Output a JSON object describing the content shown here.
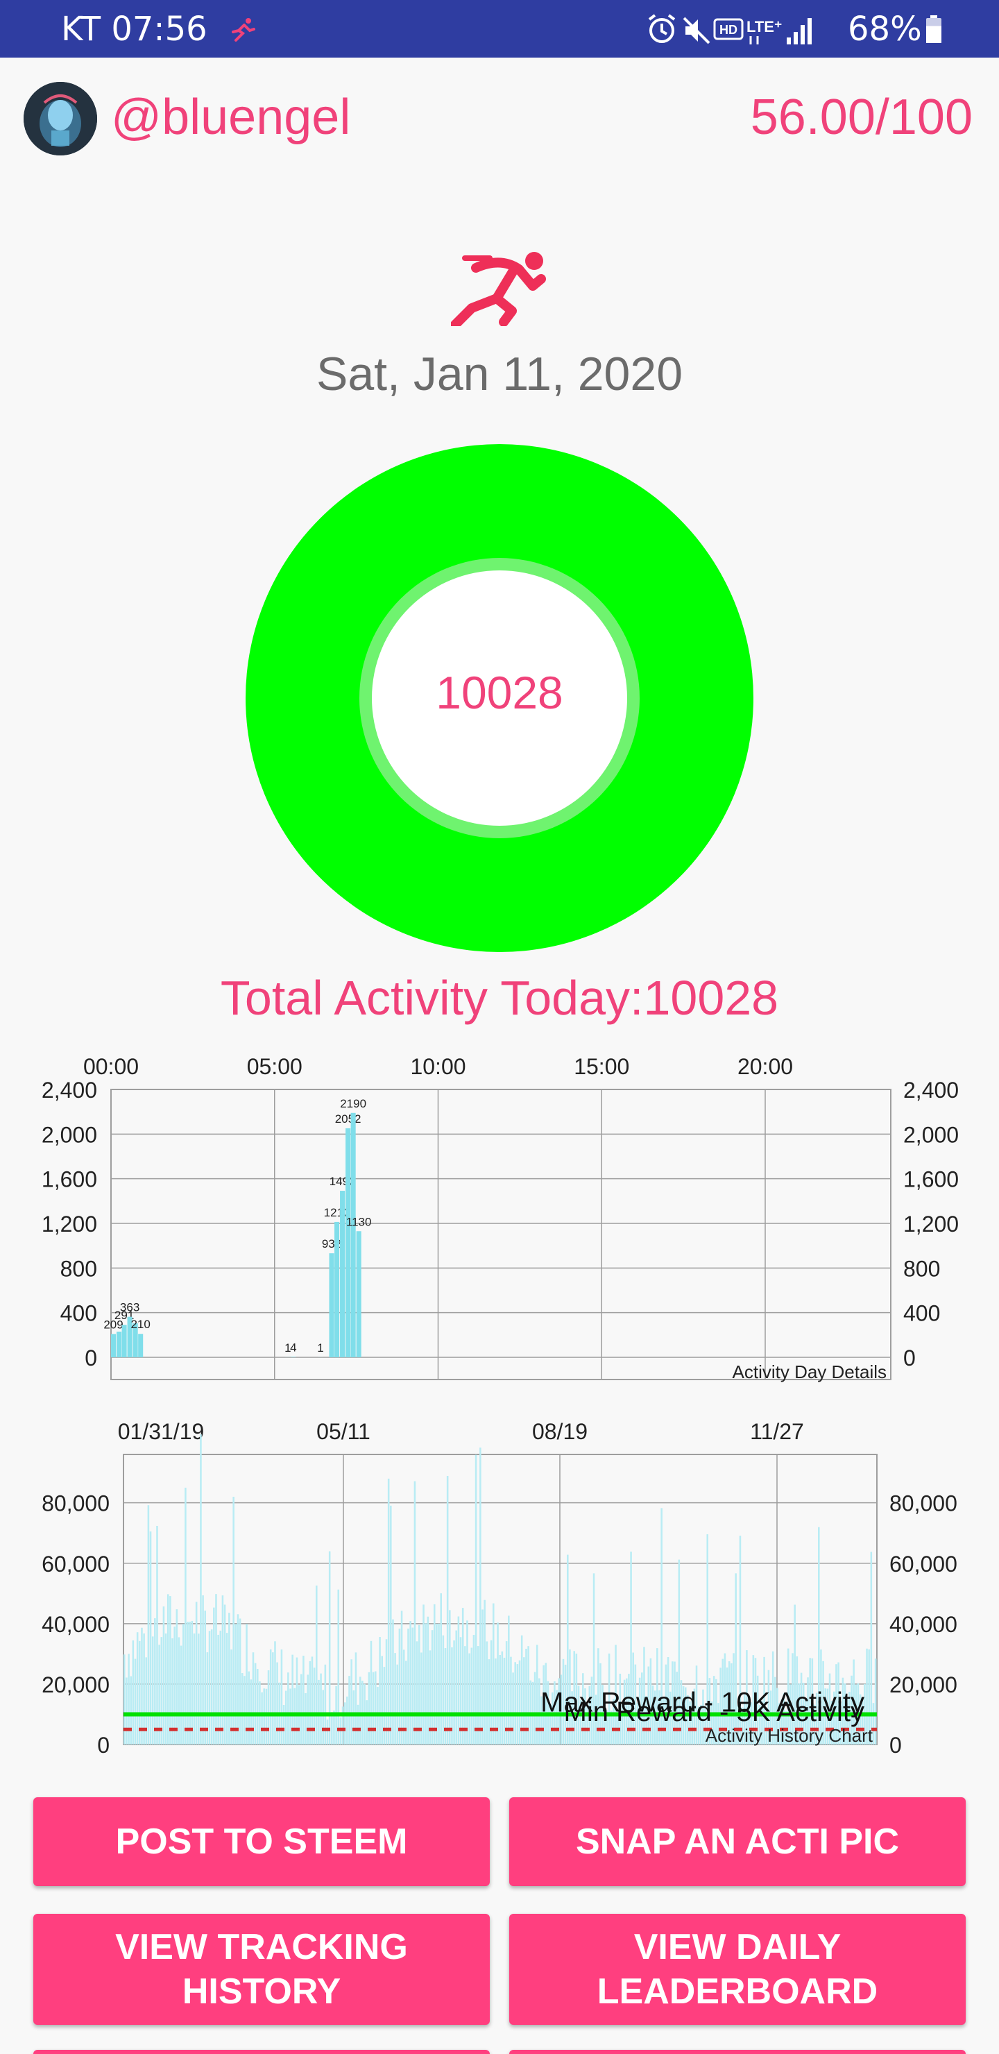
{
  "status_bar": {
    "carrier_time": "KT 07:56",
    "battery": "68%",
    "battery_level": 0.68,
    "icons": [
      "running-icon",
      "alarm-icon",
      "mute-icon",
      "hd-icon",
      "lte-icon",
      "signal-icon",
      "battery-icon"
    ]
  },
  "header": {
    "username": "@bluengel",
    "score": "56.00/100"
  },
  "summary": {
    "date": "Sat, Jan 11, 2020",
    "ring_value": "10028",
    "total_label": "Total Activity Today:10028",
    "ring_progress": 1.0
  },
  "colors": {
    "accent": "#f0427a",
    "button": "#ff3f7f",
    "ring": "#00ff00",
    "bars": "#80deea",
    "status_bar": "#2f3da1",
    "max_line": "#00e000",
    "min_line": "#d32f2f"
  },
  "chart_data": [
    {
      "type": "bar",
      "title": "Activity Day Details",
      "x_ticks": [
        "00:00",
        "05:00",
        "10:00",
        "15:00",
        "20:00"
      ],
      "x_range": [
        0,
        24
      ],
      "y_ticks": [
        "2,400",
        "2,000",
        "1,600",
        "1,200",
        "800",
        "400",
        "0"
      ],
      "y_tick_values": [
        2400,
        2000,
        1600,
        1200,
        800,
        400,
        0
      ],
      "ylim": [
        0,
        2400
      ],
      "bar_width_hours": 0.15,
      "bars": [
        {
          "x": 0.0,
          "y": 209,
          "label": "209"
        },
        {
          "x": 0.17,
          "y": 230,
          "label": ""
        },
        {
          "x": 0.33,
          "y": 291,
          "label": "291"
        },
        {
          "x": 0.5,
          "y": 363,
          "label": "363"
        },
        {
          "x": 0.67,
          "y": 305,
          "label": ""
        },
        {
          "x": 0.83,
          "y": 210,
          "label": "210"
        },
        {
          "x": 5.33,
          "y": 1,
          "label": "1"
        },
        {
          "x": 5.5,
          "y": 4,
          "label": "4"
        },
        {
          "x": 6.33,
          "y": 1,
          "label": "1"
        },
        {
          "x": 6.67,
          "y": 932,
          "label": "932"
        },
        {
          "x": 6.83,
          "y": 1213,
          "label": "1213"
        },
        {
          "x": 7.0,
          "y": 1492,
          "label": "1492"
        },
        {
          "x": 7.17,
          "y": 2052,
          "label": "2052"
        },
        {
          "x": 7.33,
          "y": 2190,
          "label": "2190"
        },
        {
          "x": 7.5,
          "y": 1130,
          "label": "1130"
        }
      ],
      "grid": true
    },
    {
      "type": "bar",
      "title": "Activity History Chart",
      "x_ticks": [
        "01/31/19",
        "05/11",
        "08/19",
        "11/27"
      ],
      "y_ticks": [
        "80,000",
        "60,000",
        "40,000",
        "20,000",
        "0"
      ],
      "y_tick_values": [
        80000,
        60000,
        40000,
        20000,
        0
      ],
      "ylim": [
        0,
        96000
      ],
      "reference_lines": [
        {
          "name": "Max Reward - 10K Activity",
          "value": 10000,
          "style": "solid"
        },
        {
          "name": "Min Reward - 5K Activity",
          "value": 5000,
          "style": "dashed"
        }
      ],
      "daily_values_note_hidden": false,
      "days": 345,
      "grid": true
    }
  ],
  "buttons": {
    "post": "POST TO STEEM",
    "snap": "SNAP AN ACTI PIC",
    "history_line1": "VIEW TRACKING",
    "history_line2": "HISTORY",
    "leader_line1": "VIEW DAILY",
    "leader_line2": "LEADERBOARD"
  }
}
